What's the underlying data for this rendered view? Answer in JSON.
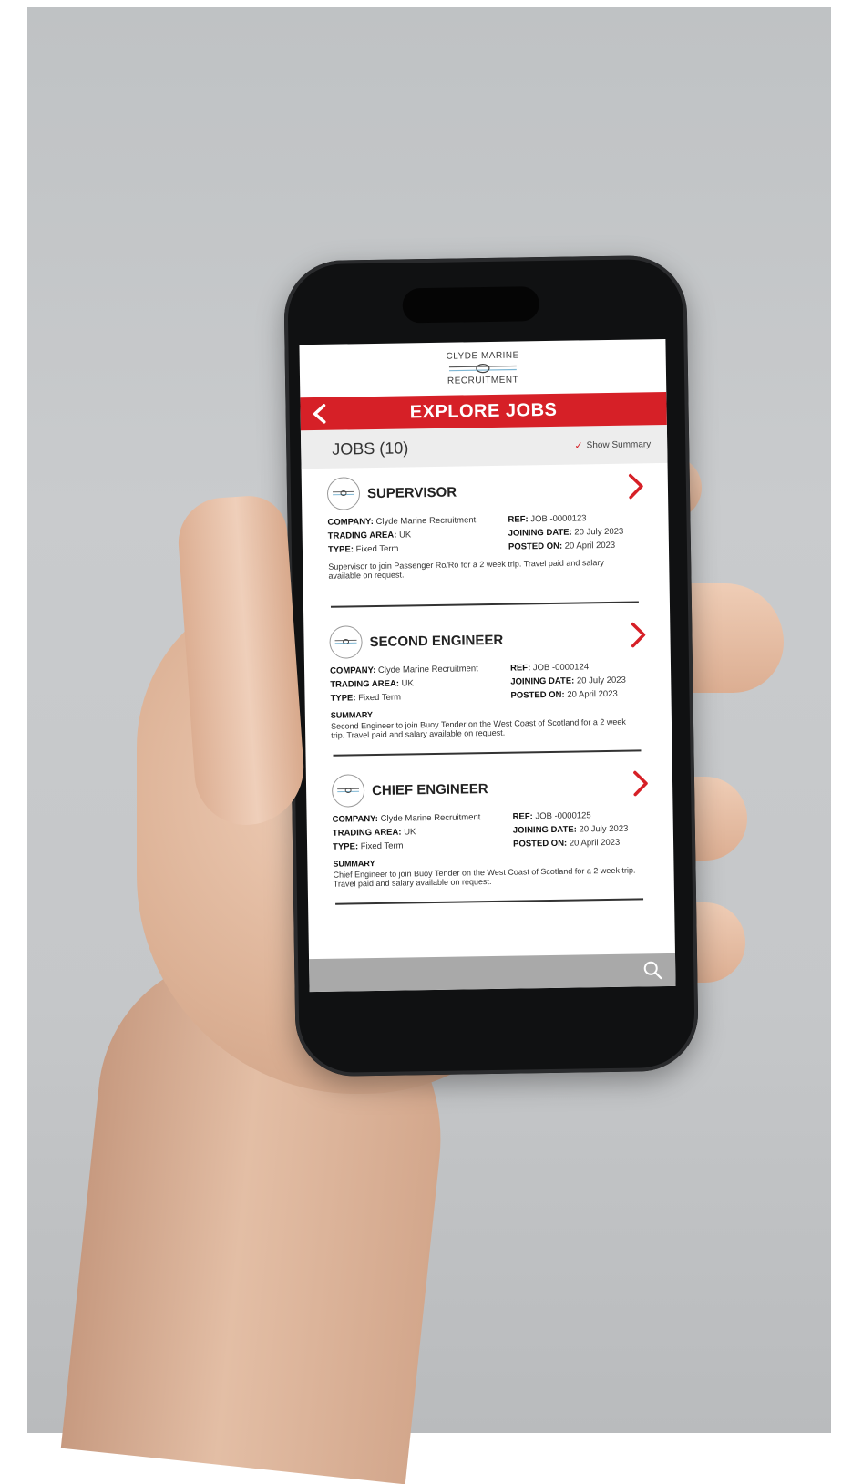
{
  "logo": {
    "line1": "CLYDE MARINE",
    "line2": "RECRUITMENT"
  },
  "header": {
    "title": "EXPLORE JOBS",
    "back_icon": "chevron-left-icon"
  },
  "list_header": {
    "count_label": "JOBS (10)",
    "summary_toggle_label": "Show Summary",
    "summary_checked": true
  },
  "jobs": [
    {
      "title": "SUPERVISOR",
      "company_label": "COMPANY:",
      "company": "Clyde Marine Recruitment",
      "area_label": "TRADING AREA:",
      "area": "UK",
      "type_label": "TYPE:",
      "type": "Fixed Term",
      "ref_label": "REF:",
      "ref": "JOB -0000123",
      "joining_label": "JOINING DATE:",
      "joining": "20 July 2023",
      "posted_label": "POSTED ON:",
      "posted": "20 April 2023",
      "summary_label": "",
      "summary": "Supervisor to join Passenger Ro/Ro for a 2 week trip. Travel paid and salary available on request."
    },
    {
      "title": "SECOND ENGINEER",
      "company_label": "COMPANY:",
      "company": "Clyde Marine Recruitment",
      "area_label": "TRADING AREA:",
      "area": "UK",
      "type_label": "TYPE:",
      "type": "Fixed Term",
      "ref_label": "REF:",
      "ref": "JOB -0000124",
      "joining_label": "JOINING DATE:",
      "joining": "20 July 2023",
      "posted_label": "POSTED ON:",
      "posted": "20 April 2023",
      "summary_label": "SUMMARY",
      "summary": "Second Engineer to join Buoy Tender on the West Coast of Scotland for a 2 week trip. Travel paid and salary available on request."
    },
    {
      "title": "CHIEF ENGINEER",
      "company_label": "COMPANY:",
      "company": "Clyde Marine Recruitment",
      "area_label": "TRADING AREA:",
      "area": "UK",
      "type_label": "TYPE:",
      "type": "Fixed Term",
      "ref_label": "REF:",
      "ref": "JOB -0000125",
      "joining_label": "JOINING DATE:",
      "joining": "20 July 2023",
      "posted_label": "POSTED ON:",
      "posted": "20 April 2023",
      "summary_label": "SUMMARY",
      "summary": "Chief Engineer to join Buoy Tender on the West Coast of Scotland for a 2 week trip. Travel paid and salary available on request."
    }
  ],
  "colors": {
    "accent": "#d62027",
    "bottom_bar": "#a9a9a9",
    "count_bar": "#ededed"
  },
  "icons": {
    "open_job": "chevron-right-icon",
    "search": "search-icon",
    "company_badge": "company-logo-icon"
  }
}
